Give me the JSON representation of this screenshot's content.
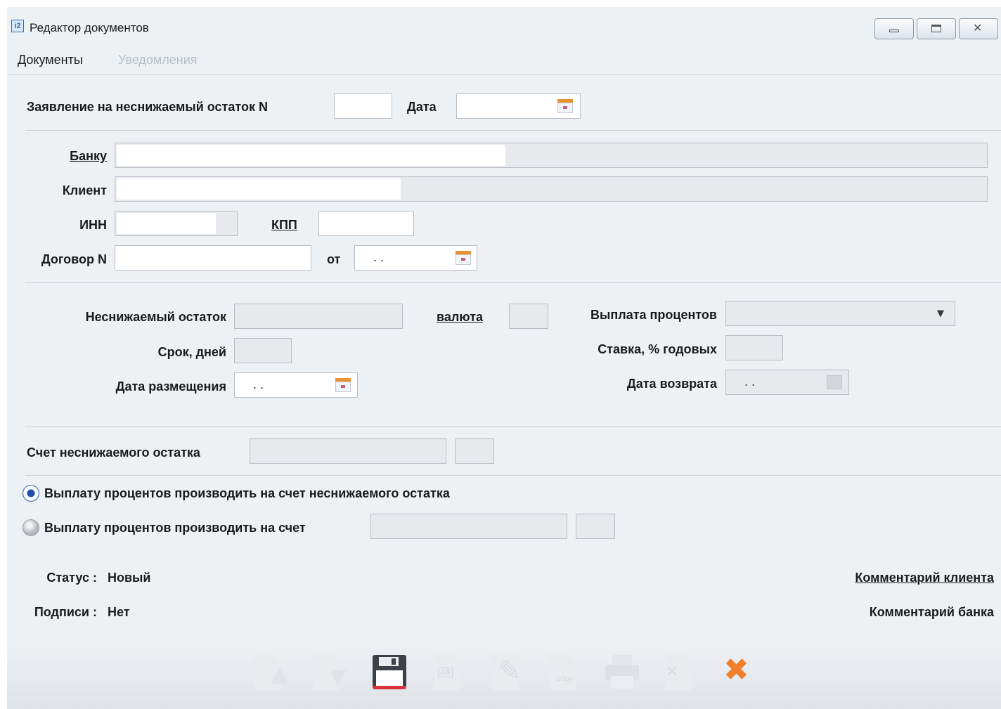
{
  "window": {
    "title": "Редактор документов",
    "app_icon": "i2-app-icon",
    "controls": [
      "minimize-icon",
      "maximize-icon",
      "close-icon"
    ]
  },
  "menu": {
    "documents": "Документы",
    "notifications": "Уведомления"
  },
  "header": {
    "statement_label": "Заявление на неснижаемый остаток N",
    "number_value": "",
    "date_label": "Дата",
    "date_value": ""
  },
  "bank": {
    "label": "Банку",
    "value": ""
  },
  "client": {
    "label": "Клиент",
    "value": ""
  },
  "inn": {
    "label": "ИНН",
    "value": ""
  },
  "kpp": {
    "label": "КПП",
    "value": ""
  },
  "contract": {
    "label": "Договор N",
    "value": "",
    "from_label": "от",
    "date_placeholder": ". ."
  },
  "deposit": {
    "min_balance_label": "Неснижаемый остаток",
    "min_balance_value": "",
    "currency_label": "валюта",
    "currency_value": "",
    "interest_payment_label": "Выплата процентов",
    "interest_payment_value": "",
    "term_label": "Срок, дней",
    "term_value": "",
    "rate_label": "Ставка, % годовых",
    "rate_value": "",
    "placement_date_label": "Дата размещения",
    "placement_date_placeholder": ". .",
    "return_date_label": "Дата возврата",
    "return_date_placeholder": ". ."
  },
  "account": {
    "label": "Счет неснижаемого остатка",
    "value": "",
    "code": ""
  },
  "payout": {
    "option1": "Выплату процентов производить на счет неснижаемого остатка",
    "option2": "Выплату процентов производить на счет",
    "selected": 1
  },
  "status": {
    "status_label": "Статус :",
    "status_value": "Новый",
    "signatures_label": "Подписи :",
    "signatures_value": "Нет"
  },
  "comments": {
    "client": "Комментарий клиента",
    "bank": "Комментарий банка"
  },
  "toolbar": {
    "buttons": [
      "import-up-icon",
      "export-down-icon",
      "save-icon",
      "text-doc-icon",
      "edit-icon",
      "copy-icon",
      "print-icon",
      "delete-doc-icon",
      "close-x-icon"
    ],
    "copy_text": "copy",
    "text_doc_text": "AB"
  },
  "colors": {
    "window_bg": "#eef1f4",
    "close_x": "#f07f2e",
    "calendar_accent": "#e8912f",
    "radio_selected": "#1f4fa8"
  }
}
